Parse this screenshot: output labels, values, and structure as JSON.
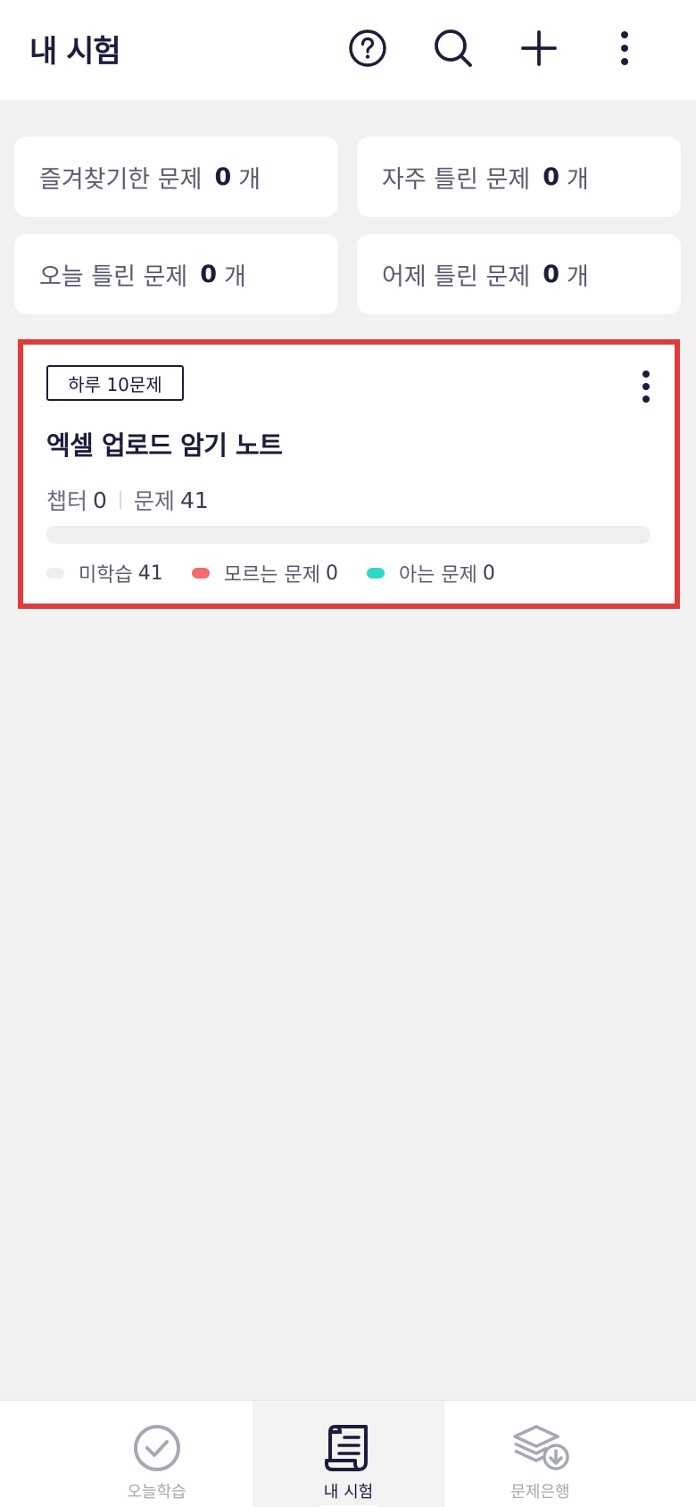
{
  "header": {
    "title": "내 시험",
    "icons": [
      "help-icon",
      "search-icon",
      "add-icon",
      "more-vertical-icon"
    ]
  },
  "stats": [
    {
      "label": "즐겨찾기한 문제",
      "count": "0",
      "unit": "개"
    },
    {
      "label": "자주 틀린 문제",
      "count": "0",
      "unit": "개"
    },
    {
      "label": "오늘 틀린 문제",
      "count": "0",
      "unit": "개"
    },
    {
      "label": "어제 틀린 문제",
      "count": "0",
      "unit": "개"
    }
  ],
  "exam": {
    "badge": "하루 10문제",
    "title": "엑셀 업로드 암기 노트",
    "chapter_label": "챕터",
    "chapter_count": "0",
    "question_label": "문제",
    "question_count": "41",
    "progress_fraction": 0,
    "legend": [
      {
        "label": "미학습",
        "value": "41",
        "color": "#efefef"
      },
      {
        "label": "모르는 문제",
        "value": "0",
        "color": "#f46b6b"
      },
      {
        "label": "아는 문제",
        "value": "0",
        "color": "#2fd6cc"
      }
    ],
    "highlight_color": "#e13b3b"
  },
  "bottom_nav": [
    {
      "label": "오늘학습",
      "icon": "check-circle-icon",
      "active": false
    },
    {
      "label": "내 시험",
      "icon": "scroll-document-icon",
      "active": true
    },
    {
      "label": "문제은행",
      "icon": "layers-download-icon",
      "active": false
    }
  ],
  "colors": {
    "primary_text": "#1b1d3a",
    "background": "#f1f1f1",
    "muted": "#a6a8b3"
  }
}
